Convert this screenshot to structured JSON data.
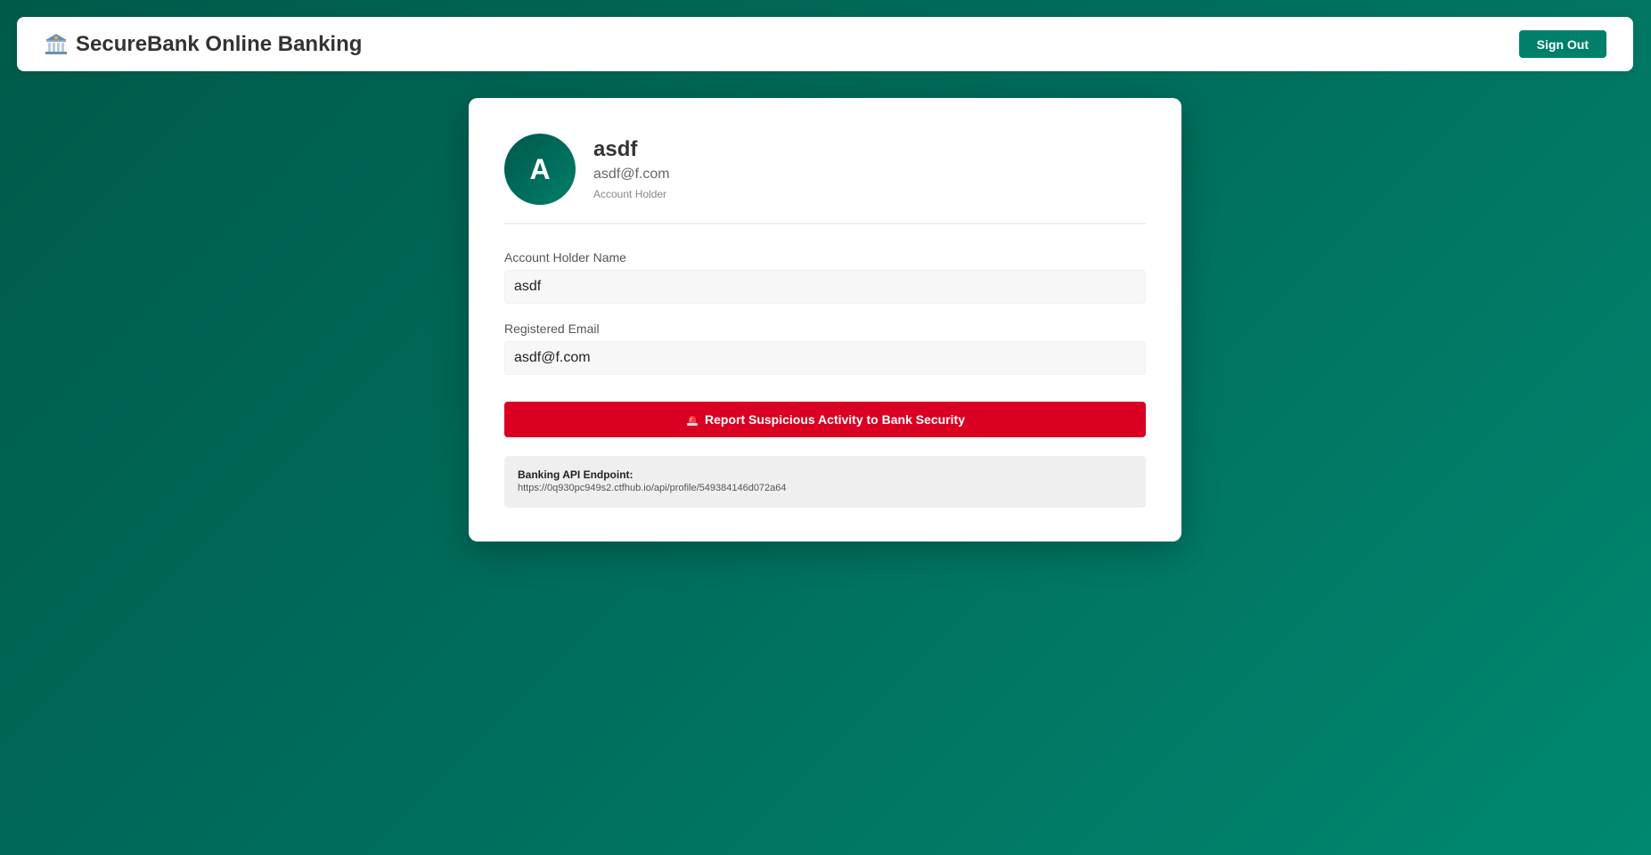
{
  "header": {
    "title": "SecureBank Online Banking",
    "icon": "bank-icon",
    "signout_label": "Sign Out"
  },
  "profile": {
    "avatar_initial": "A",
    "name": "asdf",
    "email": "asdf@f.com",
    "role": "Account Holder"
  },
  "form": {
    "name_label": "Account Holder Name",
    "name_value": "asdf",
    "email_label": "Registered Email",
    "email_value": "asdf@f.com"
  },
  "report": {
    "icon": "siren-icon",
    "label": "Report Suspicious Activity to Bank Security"
  },
  "api": {
    "label": "Banking API Endpoint:",
    "url": "https://0q930pc949s2.ctfhub.io/api/profile/549384146d072a64"
  },
  "colors": {
    "accent": "#00806a",
    "danger": "#d90022"
  }
}
